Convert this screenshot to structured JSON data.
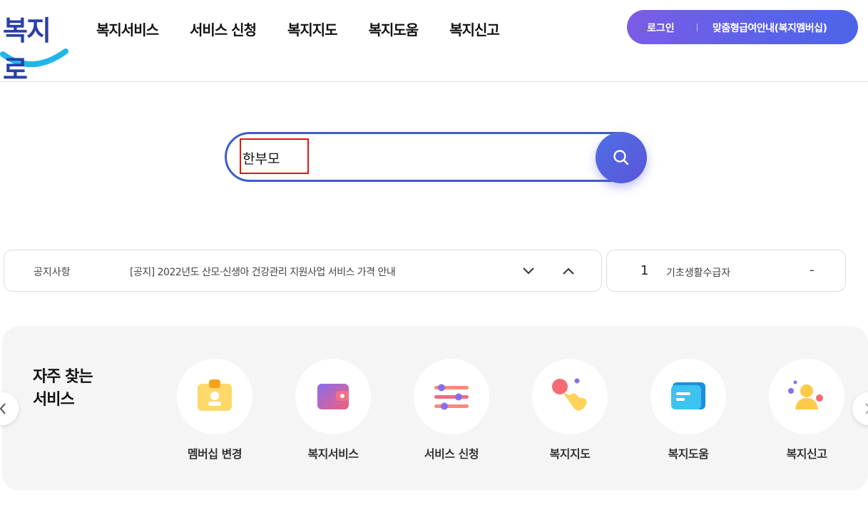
{
  "header": {
    "logo_text": "복지로",
    "nav": [
      "복지서비스",
      "서비스 신청",
      "복지지도",
      "복지도움",
      "복지신고"
    ],
    "login_label": "로그인",
    "membership_label": "맞춤형급여안내(복지멤버십)"
  },
  "search": {
    "value": "한부모",
    "button_icon": "search-icon"
  },
  "notice": {
    "label": "공지사항",
    "text": "[공지] 2022년도 산모·신생아 건강관리 지원사업 서비스 가격 안내"
  },
  "ranking": {
    "rank": "1",
    "keyword": "기초생활수급자",
    "change": "-"
  },
  "frequent": {
    "title_line1": "자주 찾는",
    "title_line2": "서비스",
    "items": [
      {
        "label": "멤버십 변경",
        "icon": "badge-icon"
      },
      {
        "label": "복지서비스",
        "icon": "wallet-icon"
      },
      {
        "label": "서비스 신청",
        "icon": "sliders-icon"
      },
      {
        "label": "복지지도",
        "icon": "hand-pointer-icon"
      },
      {
        "label": "복지도움",
        "icon": "chat-bubble-icon"
      },
      {
        "label": "복지신고",
        "icon": "user-report-icon"
      }
    ]
  },
  "colors": {
    "accent": "#4d64e8",
    "pill_start": "#7b5ce6",
    "search_border": "#3f5bc9",
    "highlight": "#e3140f",
    "panel_bg": "#f5f5f5"
  }
}
